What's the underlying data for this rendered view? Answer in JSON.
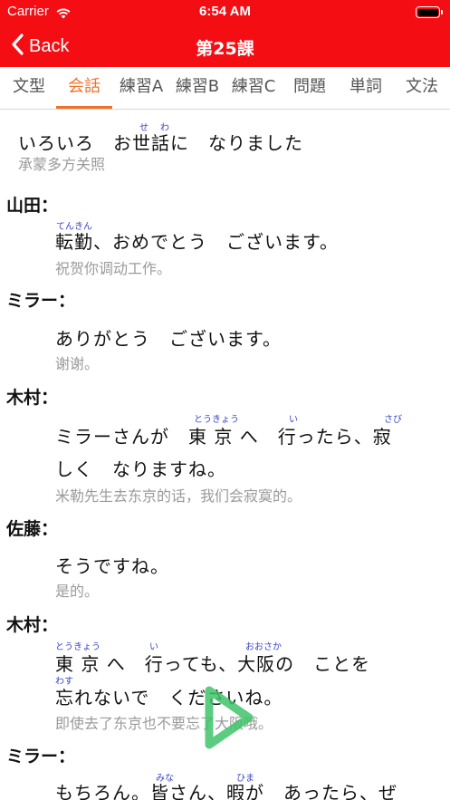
{
  "status_bar": {
    "carrier": "Carrier",
    "time": "6:54 AM",
    "battery_level": 1.0
  },
  "nav": {
    "back_label": "Back",
    "title": "第25課"
  },
  "tabs": [
    {
      "label": "文型",
      "active": false
    },
    {
      "label": "会話",
      "active": true
    },
    {
      "label": "練習A",
      "active": false
    },
    {
      "label": "練習B",
      "active": false
    },
    {
      "label": "練習C",
      "active": false
    },
    {
      "label": "問題",
      "active": false
    },
    {
      "label": "単詞",
      "active": false
    },
    {
      "label": "文法",
      "active": false
    }
  ],
  "dialogue": {
    "heading": {
      "text": "いろいろ　お世話に　なりました",
      "ruby": [
        "せ",
        "わ"
      ],
      "translation": "承蒙多方关照"
    },
    "turns": [
      {
        "speaker": "山田：",
        "lines": [
          "転勤、おめでとう　ございます。"
        ],
        "ruby": [
          "てんきん"
        ],
        "translation": "祝贺你调动工作。"
      },
      {
        "speaker": "ミラー：",
        "lines": [
          "ありがとう　ございます。"
        ],
        "ruby": [],
        "translation": "谢谢。"
      },
      {
        "speaker": "木村：",
        "lines": [
          "ミラーさんが　東 京 へ　行ったら、寂",
          "しく　なりますね。"
        ],
        "ruby": [
          "とうきょう",
          "い",
          "さび"
        ],
        "translation": "米勒先生去东京的话，我们会寂寞的。"
      },
      {
        "speaker": "佐藤：",
        "lines": [
          "そうですね。"
        ],
        "ruby": [],
        "translation": "是的。"
      },
      {
        "speaker": "木村：",
        "lines": [
          "東 京 へ　行っても、大阪の　ことを",
          "忘れないで　くださいね。"
        ],
        "ruby": [
          "とうきょう",
          "い",
          "おおさか",
          "わす"
        ],
        "translation": "即使去了东京也不要忘了大阪哦。"
      },
      {
        "speaker": "ミラー：",
        "lines": [
          "もちろん。皆さん、暇が　あったら、ぜ"
        ],
        "ruby": [
          "みな",
          "ひま"
        ],
        "translation": ""
      }
    ]
  },
  "colors": {
    "header_red": "#f40d12",
    "tab_active": "#f0712a",
    "ruby_blue": "#3a44c6",
    "translation_gray": "#9a9a9a",
    "play_green": "#3fc46a"
  },
  "icons": {
    "back": "chevron-left-icon",
    "wifi": "wifi-icon",
    "battery": "battery-icon",
    "play": "play-icon"
  }
}
